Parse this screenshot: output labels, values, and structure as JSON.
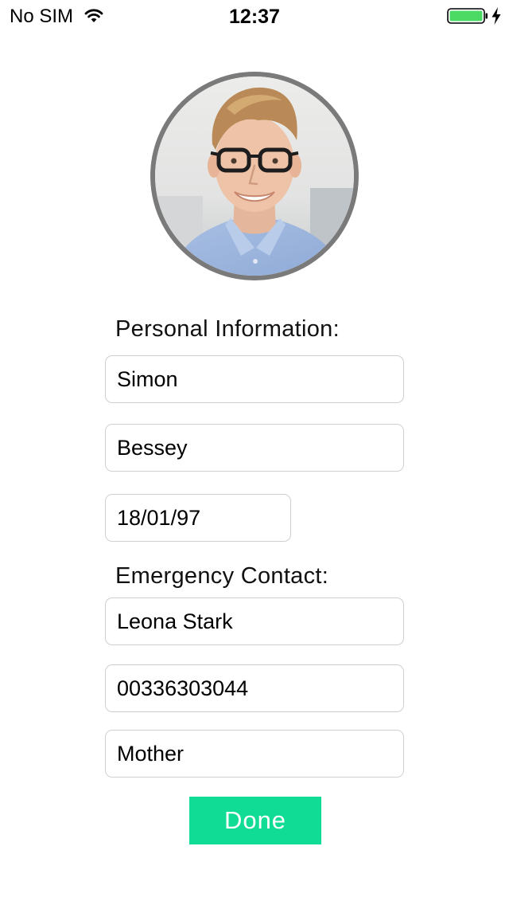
{
  "status_bar": {
    "carrier": "No SIM",
    "time": "12:37",
    "battery_color": "#4cd964"
  },
  "profile": {
    "avatar_border_color": "#7a7a7a"
  },
  "personal": {
    "label": "Personal Information:",
    "first_name": "Simon",
    "last_name": "Bessey",
    "date_of_birth": "18/01/97"
  },
  "emergency": {
    "label": "Emergency Contact:",
    "name": "Leona Stark",
    "phone": "00336303044",
    "relationship": "Mother"
  },
  "actions": {
    "done_label": "Done",
    "done_color": "#11dc95"
  },
  "icons": [
    "wifi-icon",
    "battery-icon",
    "charging-icon"
  ]
}
